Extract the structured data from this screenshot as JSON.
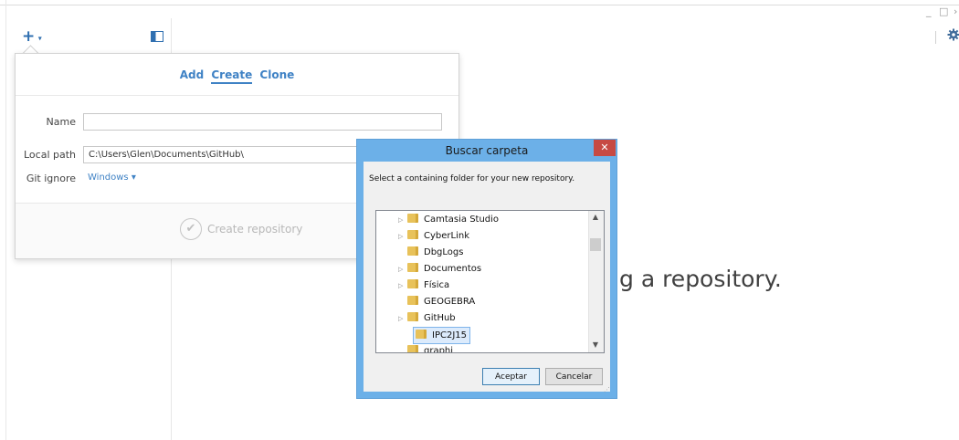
{
  "window": {
    "controls": {
      "minimize": "_",
      "maximize": "□",
      "more": "›"
    }
  },
  "toolbar": {
    "add_symbol": "+",
    "add_caret": "▾"
  },
  "popover": {
    "tabs": [
      {
        "label": "Add",
        "active": false
      },
      {
        "label": "Create",
        "active": true
      },
      {
        "label": "Clone",
        "active": false
      }
    ],
    "name_label": "Name",
    "name_value": "",
    "local_path_label": "Local path",
    "local_path_value": "C:\\Users\\Glen\\Documents\\GitHub\\",
    "git_ignore_label": "Git ignore",
    "git_ignore_value": "Windows ▾",
    "create_button_label": "Create repository"
  },
  "background_text": "g a repository.",
  "dialog": {
    "title": "Buscar carpeta",
    "close_symbol": "✕",
    "message": "Select a containing folder for your new repository.",
    "folders": [
      {
        "name": "Camtasia Studio",
        "expandable": true,
        "selected": false
      },
      {
        "name": "CyberLink",
        "expandable": true,
        "selected": false
      },
      {
        "name": "DbgLogs",
        "expandable": false,
        "selected": false
      },
      {
        "name": "Documentos",
        "expandable": true,
        "selected": false
      },
      {
        "name": "Física",
        "expandable": true,
        "selected": false
      },
      {
        "name": "GEOGEBRA",
        "expandable": false,
        "selected": false
      },
      {
        "name": "GitHub",
        "expandable": true,
        "selected": false
      },
      {
        "name": "IPC2J15",
        "expandable": false,
        "selected": true
      },
      {
        "name": "graphi",
        "expandable": false,
        "selected": false
      }
    ],
    "ok_label": "Aceptar",
    "cancel_label": "Cancelar"
  },
  "colors": {
    "accent": "#3f82c5",
    "dialog_frame": "#6cb0e8",
    "close_button": "#c74a43"
  }
}
